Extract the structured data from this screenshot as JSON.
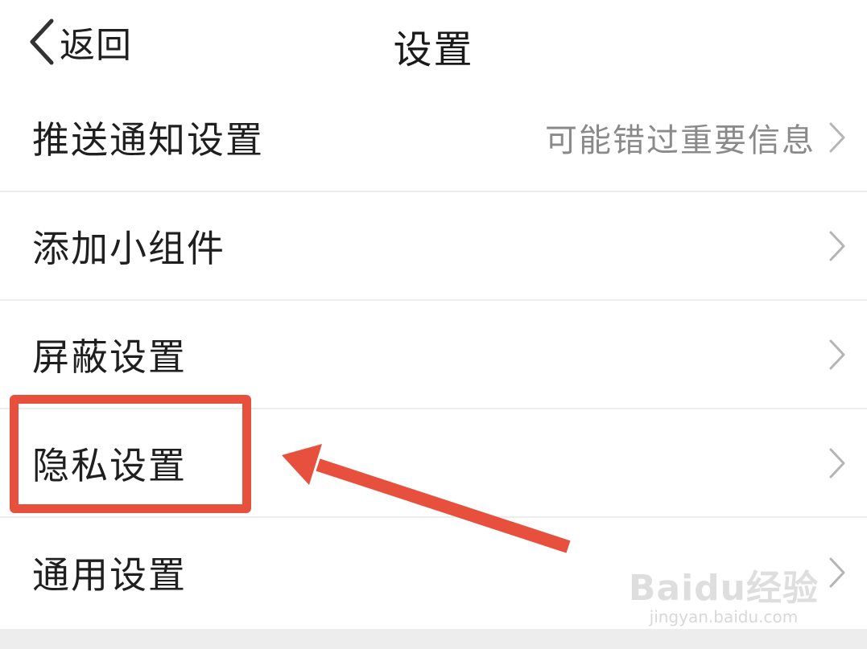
{
  "nav": {
    "back_label": "返回",
    "title": "设置"
  },
  "settings": [
    {
      "label": "推送通知设置",
      "value": "可能错过重要信息"
    },
    {
      "label": "添加小组件",
      "value": ""
    },
    {
      "label": "屏蔽设置",
      "value": ""
    },
    {
      "label": "隐私设置",
      "value": ""
    },
    {
      "label": "通用设置",
      "value": ""
    }
  ],
  "annotation": {
    "color": "#e8503e",
    "highlighted_item": "隐私设置"
  },
  "watermark": {
    "brand": "Baidu经验",
    "url": "jingyan.baidu.com"
  },
  "icons": {
    "back": "chevron-left-icon",
    "row_arrow": "chevron-right-icon"
  }
}
